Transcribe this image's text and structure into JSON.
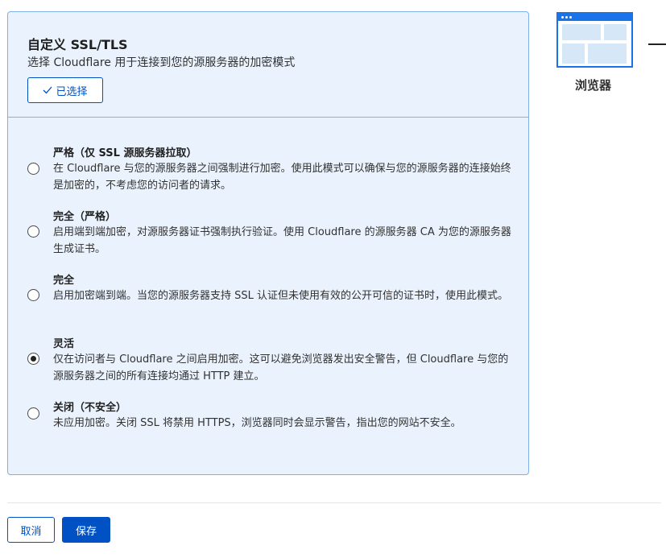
{
  "panel": {
    "title": "自定义 SSL/TLS",
    "subtitle": "选择 Cloudflare 用于连接到您的源服务器的加密模式",
    "selected_label": "已选择"
  },
  "options": [
    {
      "title": "严格（仅 SSL 源服务器拉取）",
      "desc": "在 Cloudflare 与您的源服务器之间强制进行加密。使用此模式可以确保与您的源服务器的连接始终是加密的，不考虑您的访问者的请求。",
      "checked": false
    },
    {
      "title": "完全（严格）",
      "desc": "启用端到端加密，对源服务器证书强制执行验证。使用 Cloudflare 的源服务器 CA 为您的源服务器生成证书。",
      "checked": false
    },
    {
      "title": "完全",
      "desc": "启用加密端到端。当您的源服务器支持 SSL 认证但未使用有效的公开可信的证书时，使用此模式。",
      "checked": false
    },
    {
      "title": "灵活",
      "desc": "仅在访问者与 Cloudflare 之间启用加密。这可以避免浏览器发出安全警告，但 Cloudflare 与您的源服务器之间的所有连接均通过 HTTP 建立。",
      "checked": true
    },
    {
      "title": "关闭（不安全）",
      "desc": "未应用加密。关闭 SSL 将禁用 HTTPS，浏览器同时会显示警告，指出您的网站不安全。",
      "checked": false
    }
  ],
  "diagram": {
    "browser_label": "浏览器"
  },
  "footer": {
    "cancel_label": "取消",
    "save_label": "保存"
  },
  "colors": {
    "accent": "#0051c3",
    "panel_bg": "#eaf3fd",
    "panel_border": "#7fb0e6"
  }
}
